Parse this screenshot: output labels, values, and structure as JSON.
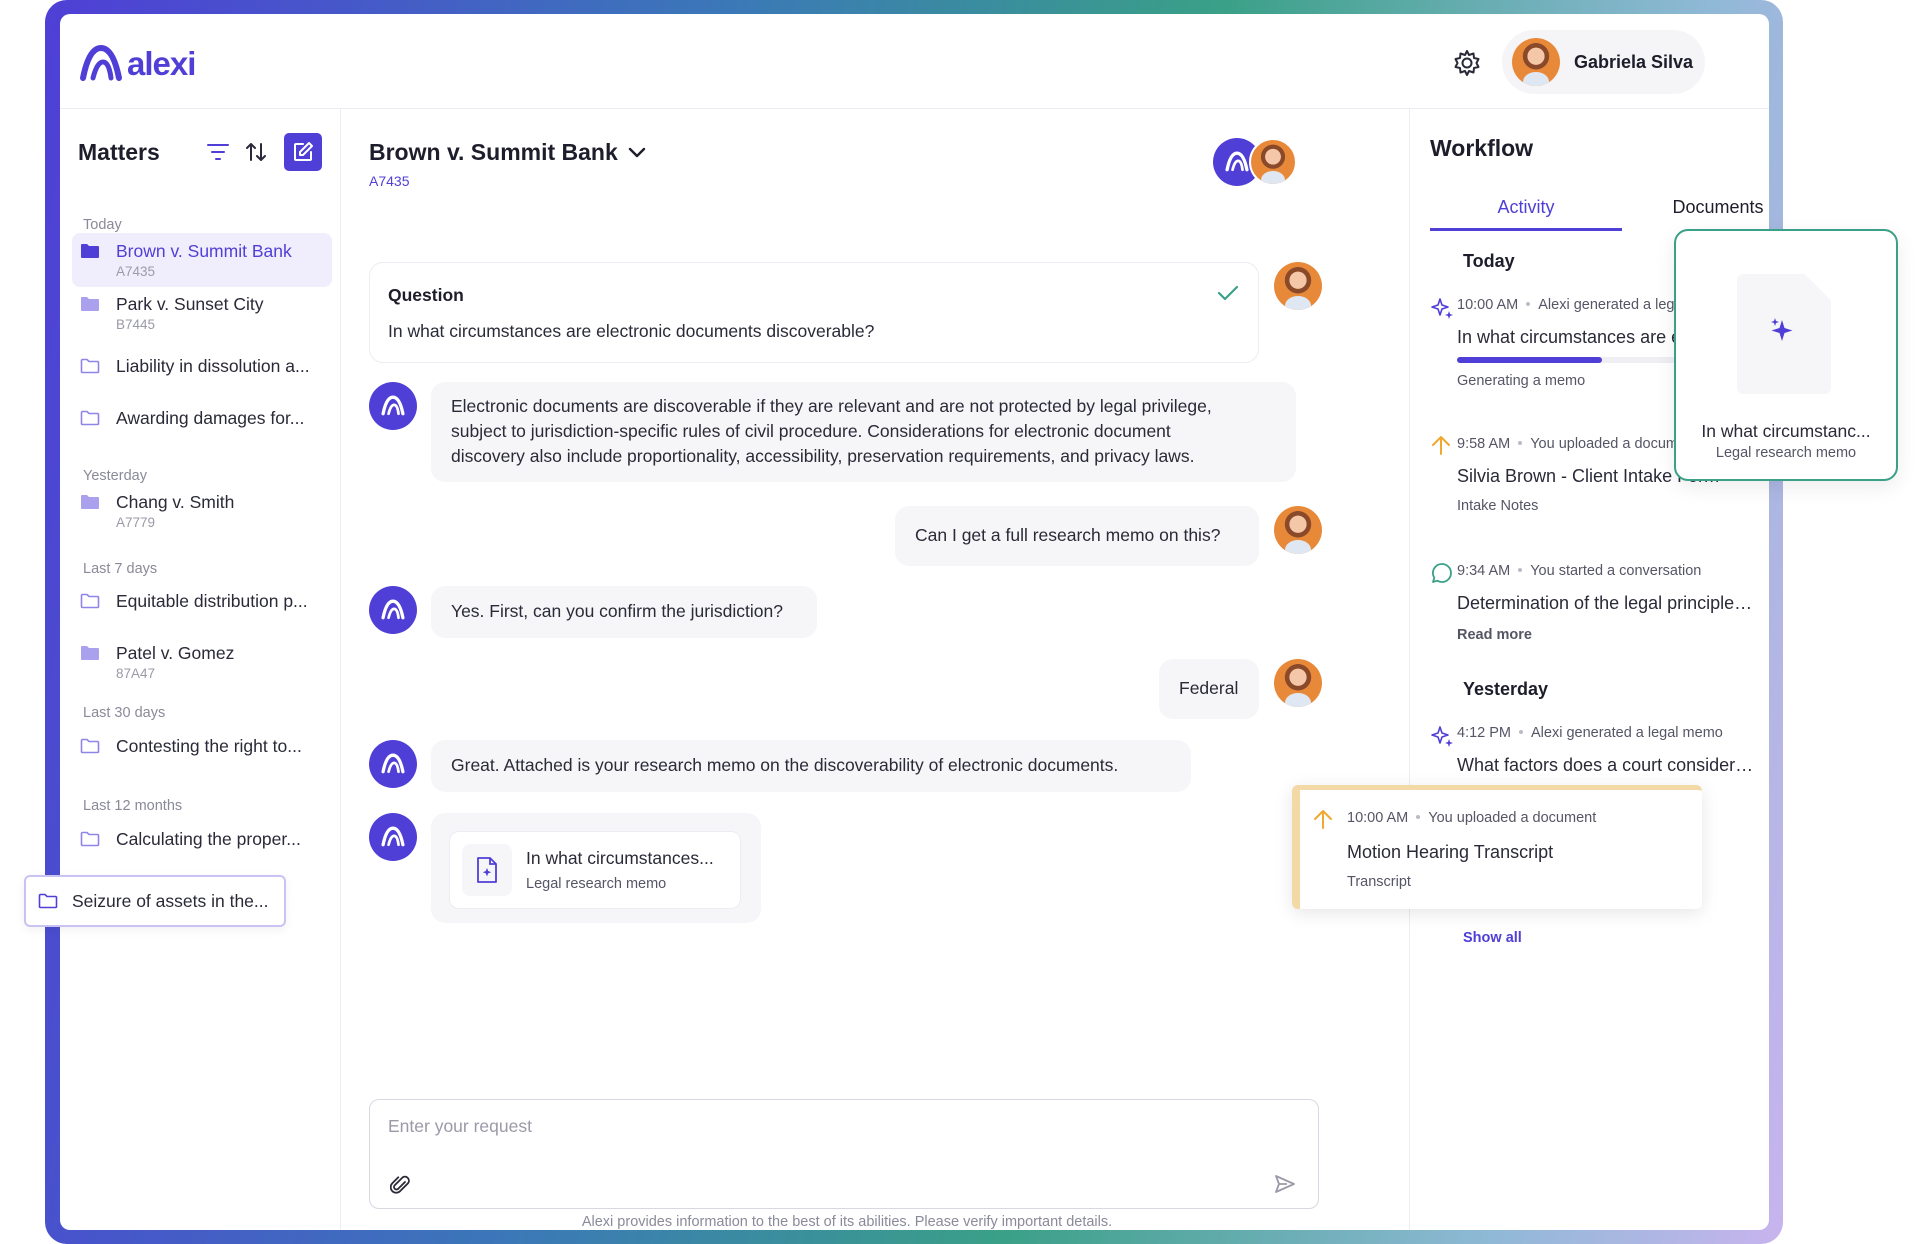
{
  "brand": {
    "name": "alexi",
    "color": "#4f3fd6"
  },
  "header": {
    "user_name": "Gabriela Silva",
    "settings_icon": "gear-icon"
  },
  "sidebar": {
    "title": "Matters",
    "groups": [
      {
        "label": "Today",
        "items": [
          {
            "name": "Brown v. Summit Bank",
            "code": "A7435",
            "active": true,
            "filled": true
          },
          {
            "name": "Park v. Sunset City",
            "code": "B7445",
            "filled": true
          },
          {
            "name": "Liability in dissolution a...",
            "code": "",
            "filled": false
          },
          {
            "name": "Awarding damages for...",
            "code": "",
            "filled": false
          }
        ]
      },
      {
        "label": "Yesterday",
        "items": [
          {
            "name": "Chang v. Smith",
            "code": "A7779",
            "filled": true
          }
        ]
      },
      {
        "label": "Last 7 days",
        "items": [
          {
            "name": "Equitable distribution p...",
            "code": "",
            "filled": false
          },
          {
            "name": "Patel v. Gomez",
            "code": "87A47",
            "filled": true
          }
        ]
      },
      {
        "label": "Last 30 days",
        "items": [
          {
            "name": "Contesting the right to...",
            "code": "",
            "filled": false
          }
        ]
      },
      {
        "label": "Last 12 months",
        "items": [
          {
            "name": "Calculating the proper...",
            "code": "",
            "filled": false
          }
        ]
      }
    ],
    "dragging_item": "Seizure of assets in the..."
  },
  "chat": {
    "case_title": "Brown v. Summit Bank",
    "case_code": "A7435",
    "question_label": "Question",
    "question_text": "In what circumstances are electronic documents discoverable?",
    "answer_1_line1": "Electronic documents are discoverable if they are relevant and are not protected by legal privilege,",
    "answer_1_line2": "subject to jurisdiction-specific rules of civil procedure. Considerations for electronic document",
    "answer_1_line3": "discovery also include proportionality, accessibility, preservation requirements, and privacy laws.",
    "user_msg_1": "Can I get a full research memo on this?",
    "bot_msg_2": "Yes. First, can you confirm the jurisdiction?",
    "user_msg_2": "Federal",
    "bot_msg_3": "Great. Attached is your research memo on the discoverability of electronic documents.",
    "attachment_title": "In what circumstances...",
    "attachment_sub": "Legal research memo",
    "input_placeholder": "Enter your request",
    "disclaimer": "Alexi provides information to the best of its abilities. Please verify important details."
  },
  "workflow": {
    "title": "Workflow",
    "tabs": [
      {
        "label": "Activity",
        "active": true
      },
      {
        "label": "Documents",
        "active": false
      }
    ],
    "today_label": "Today",
    "yesterday_label": "Yesterday",
    "activities": [
      {
        "icon": "sparkle-icon",
        "time": "10:00 AM",
        "action": "Alexi generated a legal me",
        "title": "In what circumstances are electr",
        "sub": "Generating a memo",
        "progress": 0.5
      },
      {
        "icon": "upload-arrow-icon",
        "time": "9:58 AM",
        "action": "You uploaded a document",
        "title": "Silvia Brown - Client Intake Form",
        "sub": "Intake Notes"
      },
      {
        "icon": "chat-bubble-icon",
        "time": "9:34 AM",
        "action": "You started a conversation",
        "title": "Determination of the legal principles wh...",
        "sub": "Read more"
      },
      {
        "icon": "sparkle-icon",
        "time": "4:12 PM",
        "action": "Alexi generated a legal memo",
        "title": "What factors does a court consider wh...",
        "sub": ""
      }
    ],
    "show_all": "Show all"
  },
  "float_doc": {
    "title": "In what circumstanc...",
    "sub": "Legal research memo"
  },
  "float_upload": {
    "time": "10:00 AM",
    "action": "You uploaded a document",
    "title": "Motion Hearing Transcript",
    "sub": "Transcript"
  }
}
